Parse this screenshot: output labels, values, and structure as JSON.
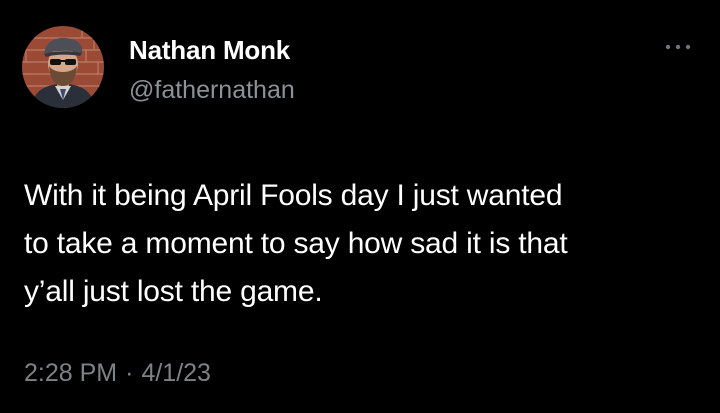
{
  "tweet": {
    "author": {
      "display_name": "Nathan Monk",
      "handle": "@fathernathan",
      "avatar_icon": "profile-photo-man-in-flat-cap-and-sunglasses"
    },
    "more_icon": "ellipsis-icon",
    "text_lines": [
      "With it being April Fools day I just wanted",
      "to take a moment to say how sad it is that",
      "y’all just lost the game."
    ],
    "time": "2:28 PM",
    "separator": "·",
    "date": "4/1/23"
  },
  "colors": {
    "background": "#000000",
    "primary_text": "#ffffff",
    "secondary_text": "#8b9196"
  }
}
